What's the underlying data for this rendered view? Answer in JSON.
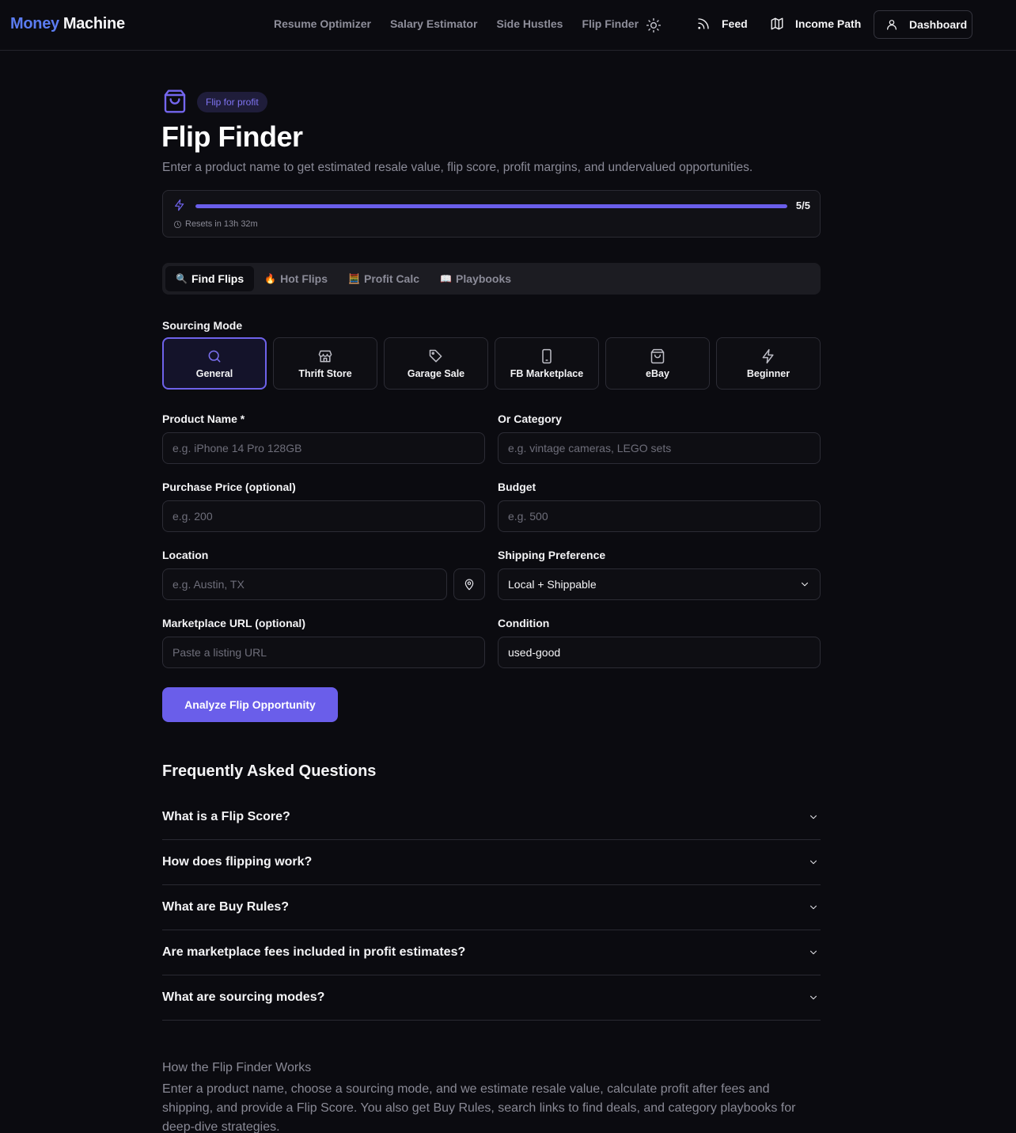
{
  "header": {
    "logo_part1": "Money",
    "logo_part2": "Machine",
    "nav": [
      "Resume Optimizer",
      "Salary Estimator",
      "Side Hustles",
      "Flip Finder"
    ],
    "feed_label": "Feed",
    "income_path_label": "Income Path",
    "dashboard_label": "Dashboard"
  },
  "hero": {
    "badge": "Flip for profit",
    "title": "Flip Finder",
    "subtitle": "Enter a product name to get estimated resale value, flip score, profit margins, and undervalued opportunities."
  },
  "usage": {
    "count_label": "5/5",
    "used": 5,
    "limit": 5,
    "reset_label": "Resets in 13h 32m"
  },
  "tabs": [
    {
      "emoji": "🔍",
      "label": "Find Flips",
      "active": true
    },
    {
      "emoji": "🔥",
      "label": "Hot Flips",
      "active": false
    },
    {
      "emoji": "🧮",
      "label": "Profit Calc",
      "active": false
    },
    {
      "emoji": "📖",
      "label": "Playbooks",
      "active": false
    }
  ],
  "sourcing": {
    "label": "Sourcing Mode",
    "modes": [
      {
        "label": "General",
        "icon": "search-icon",
        "active": true
      },
      {
        "label": "Thrift Store",
        "icon": "store-icon",
        "active": false
      },
      {
        "label": "Garage Sale",
        "icon": "tag-icon",
        "active": false
      },
      {
        "label": "FB Marketplace",
        "icon": "smartphone-icon",
        "active": false
      },
      {
        "label": "eBay",
        "icon": "shopping-bag-icon",
        "active": false
      },
      {
        "label": "Beginner",
        "icon": "bolt-icon",
        "active": false
      }
    ]
  },
  "form": {
    "product_name": {
      "label": "Product Name *",
      "placeholder": "e.g. iPhone 14 Pro 128GB",
      "value": ""
    },
    "category": {
      "label": "Or Category",
      "placeholder": "e.g. vintage cameras, LEGO sets",
      "value": ""
    },
    "purchase_price": {
      "label": "Purchase Price (optional)",
      "placeholder": "e.g. 200",
      "value": ""
    },
    "budget": {
      "label": "Budget",
      "placeholder": "e.g. 500",
      "value": ""
    },
    "location": {
      "label": "Location",
      "placeholder": "e.g. Austin, TX",
      "value": ""
    },
    "shipping": {
      "label": "Shipping Preference",
      "value": "Local + Shippable"
    },
    "marketplace_url": {
      "label": "Marketplace URL (optional)",
      "placeholder": "Paste a listing URL",
      "value": ""
    },
    "condition": {
      "label": "Condition",
      "value": "used-good"
    },
    "submit_label": "Analyze Flip Opportunity"
  },
  "faq": {
    "title": "Frequently Asked Questions",
    "items": [
      "What is a Flip Score?",
      "How does flipping work?",
      "What are Buy Rules?",
      "Are marketplace fees included in profit estimates?",
      "What are sourcing modes?"
    ]
  },
  "how_it_works": {
    "title": "How the Flip Finder Works",
    "body": "Enter a product name, choose a sourcing mode, and we estimate resale value, calculate profit after fees and shipping, and provide a Flip Score. You also get Buy Rules, search links to find deals, and category playbooks for deep-dive strategies."
  },
  "colors": {
    "accent": "#6a5eea",
    "background": "#0b0b10",
    "logo_blue": "#5b7cf0"
  }
}
